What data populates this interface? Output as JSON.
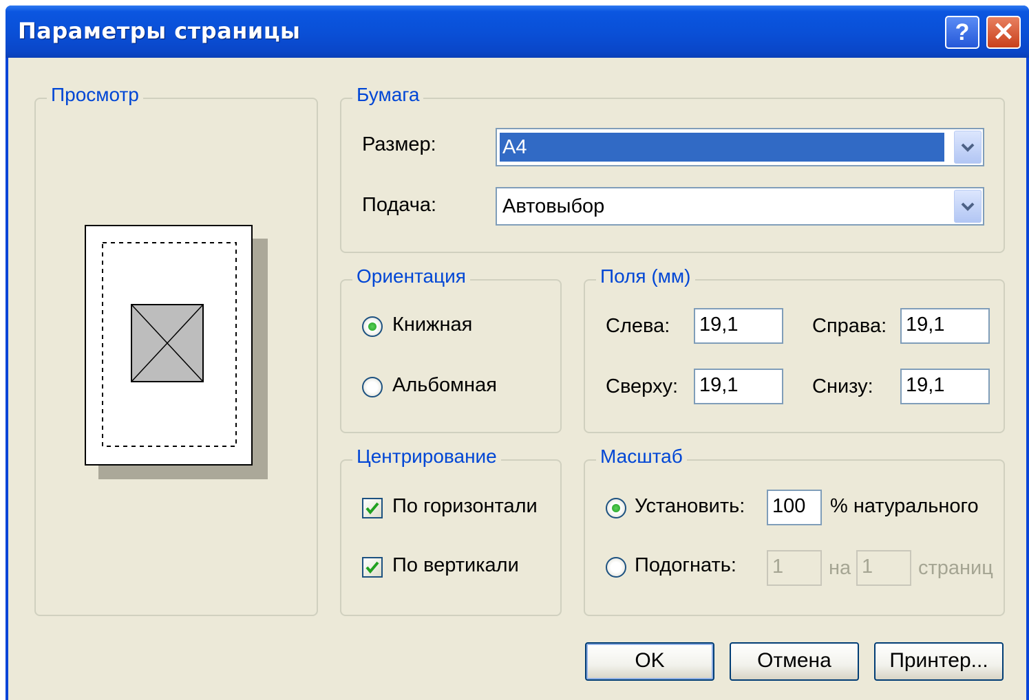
{
  "window": {
    "title": "Параметры страницы",
    "help_glyph": "?",
    "close_glyph": "✕"
  },
  "preview": {
    "legend": "Просмотр"
  },
  "paper": {
    "legend": "Бумага",
    "size_label": "Размер:",
    "size_value": "A4",
    "source_label": "Подача:",
    "source_value": "Автовыбор"
  },
  "orientation": {
    "legend": "Ориентация",
    "portrait_label": "Книжная",
    "landscape_label": "Альбомная",
    "selected": "portrait"
  },
  "margins": {
    "legend": "Поля (мм)",
    "left_label": "Слева:",
    "left_value": "19,1",
    "right_label": "Справа:",
    "right_value": "19,1",
    "top_label": "Сверху:",
    "top_value": "19,1",
    "bottom_label": "Снизу:",
    "bottom_value": "19,1"
  },
  "centering": {
    "legend": "Центрирование",
    "horizontal_label": "По горизонтали",
    "horizontal_checked": true,
    "vertical_label": "По вертикали",
    "vertical_checked": true
  },
  "scale": {
    "legend": "Масштаб",
    "adjust_label": "Установить:",
    "adjust_value": "100",
    "adjust_suffix": "% натурального",
    "fit_label": "Подогнать:",
    "fit_wide_value": "1",
    "fit_mid": "на",
    "fit_tall_value": "1",
    "fit_suffix": "страниц",
    "selected": "adjust"
  },
  "buttons": {
    "ok": "OK",
    "cancel": "Отмена",
    "printer": "Принтер..."
  },
  "colors": {
    "titlebar": "#0a4fd6",
    "dialog_bg": "#ece9d8",
    "legend_text": "#0046d5",
    "selection": "#316ac5"
  }
}
